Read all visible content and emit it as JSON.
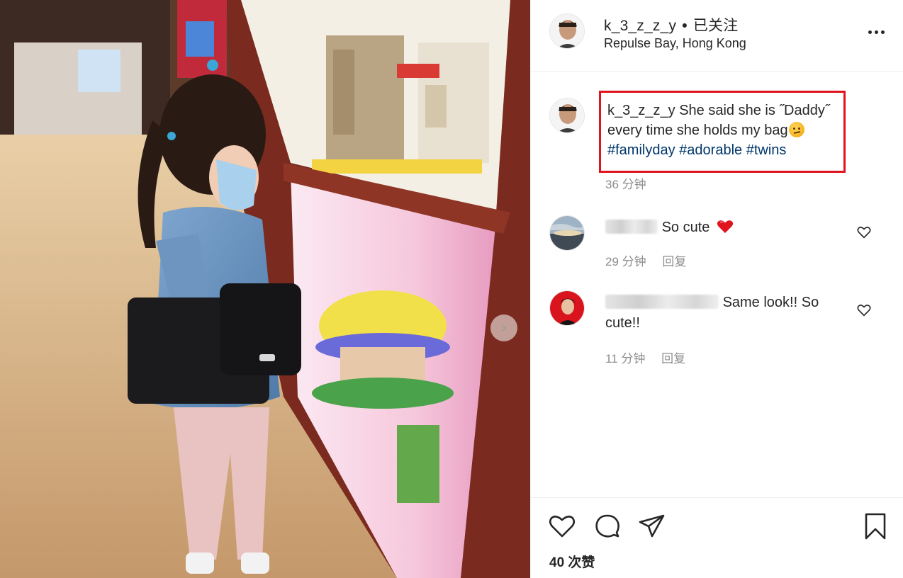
{
  "post": {
    "author": {
      "username": "k_3_z_z_y",
      "separator": "•",
      "follow_status": "已关注",
      "location": "Repulse Bay, Hong Kong",
      "avatar_icon": "user-avatar"
    },
    "more_icon": "more-options-icon",
    "next_icon": "chevron-right-icon",
    "caption": {
      "username": "k_3_z_z_y",
      "text": "She said she is ˝Daddy˝ every time she holds my bag",
      "emoji": "thinking-face-emoji",
      "hashtags": [
        "#familyday",
        "#adorable",
        "#twins"
      ],
      "time": "36 分钟"
    },
    "comments": [
      {
        "text": "So cute",
        "emoji": "red-heart-emoji",
        "time": "29 分钟",
        "reply_label": "回复",
        "avatar_icon": "sea-sunset-avatar"
      },
      {
        "text": "Same look!! So cute!!",
        "time": "11 分钟",
        "reply_label": "回复",
        "avatar_icon": "red-portrait-avatar"
      }
    ],
    "actions": {
      "like_icon": "heart-icon",
      "comment_icon": "comment-icon",
      "share_icon": "share-icon",
      "save_icon": "bookmark-icon"
    },
    "likes": "40 次赞"
  },
  "colors": {
    "highlight_border": "#e0141e",
    "hashtag": "#00376b",
    "meta_text": "#8e8e8e",
    "primary_text": "#262626"
  }
}
